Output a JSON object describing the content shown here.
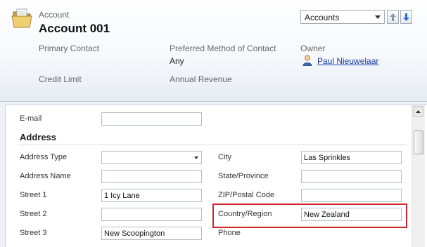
{
  "header": {
    "entity_type": "Account",
    "record_name": "Account 001",
    "form_selector": {
      "selected": "Accounts"
    },
    "fields": {
      "primary_contact": {
        "label": "Primary Contact",
        "value": ""
      },
      "preferred_method": {
        "label": "Preferred Method of Contact",
        "value": "Any"
      },
      "owner": {
        "label": "Owner",
        "value": "Paul Nieuwelaar"
      },
      "credit_limit": {
        "label": "Credit Limit",
        "value": ""
      },
      "annual_revenue": {
        "label": "Annual Revenue",
        "value": ""
      }
    }
  },
  "form": {
    "email": {
      "label": "E-mail",
      "value": ""
    },
    "address_section": {
      "title": "Address",
      "left": [
        {
          "label": "Address Type",
          "value": ""
        },
        {
          "label": "Address Name",
          "value": ""
        },
        {
          "label": "Street 1",
          "value": "1 Icy Lane"
        },
        {
          "label": "Street 2",
          "value": ""
        },
        {
          "label": "Street 3",
          "value": "New Scoopington"
        }
      ],
      "right": [
        {
          "label": "City",
          "value": "Las Sprinkles"
        },
        {
          "label": "State/Province",
          "value": ""
        },
        {
          "label": "ZIP/Postal Code",
          "value": ""
        },
        {
          "label": "Country/Region",
          "value": "New Zealand"
        },
        {
          "label": "Phone",
          "value": ""
        }
      ]
    }
  },
  "colors": {
    "highlight_border": "#d0272c",
    "link": "#1a3fa7"
  }
}
